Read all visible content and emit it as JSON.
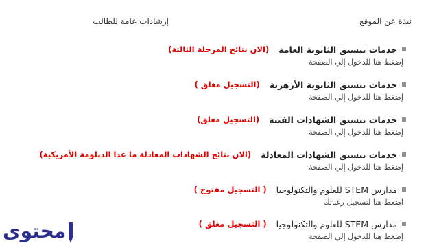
{
  "nav": {
    "about": "نبذة عن الموقع",
    "guidance": "إرشادات عامة للطالب"
  },
  "services": [
    {
      "title": "خدمات تنسيق الثانوية العامة",
      "badge": "(الان نتائج المرحلة الثالثة)",
      "subtitle": "إضغط هنا للدخول إلي الصفحة"
    },
    {
      "title": "خدمات تنسيق الثانوية الأزهرية",
      "badge": "(التسجيل مغلق )",
      "subtitle": "إضغط هنا للدخول إلي الصفحة"
    },
    {
      "title": "خدمات تنسيق الشهادات الفنية",
      "badge": "(التسجيل مغلق)",
      "subtitle": "إضغط هنا للدخول إلي الصفحة"
    },
    {
      "title": "خدمات تنسيق الشهادات المعادلة",
      "badge": "(الان نتائج الشهادات المعادلة ما عدا الدبلومة الأمريكية)",
      "subtitle": "إضغط هنا للدخول إلي الصفحة"
    },
    {
      "title": "مدارس STEM للعلوم والتكنولوجيا",
      "badge": "( التسجيل مفتوح )",
      "subtitle": "اضغط هنا لتسجيل رغباتك"
    },
    {
      "title": "مدارس STEM للعلوم والتكنولوجيا",
      "badge": "( التسجيل مغلق )",
      "subtitle": "إضغط هنا للدخول إلي الصفحة"
    }
  ],
  "logo": {
    "text": "محتوى"
  },
  "colors": {
    "badge": "#e00000",
    "bullet": "#8f8f8f",
    "logo": "#2c2f8f"
  }
}
